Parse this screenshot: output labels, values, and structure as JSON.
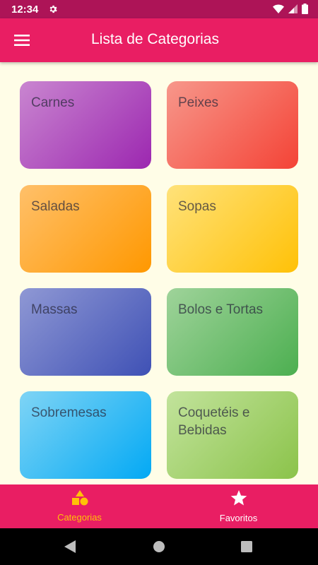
{
  "status": {
    "time": "12:34"
  },
  "app_bar": {
    "title": "Lista de Categorias"
  },
  "categories": [
    {
      "label": "Carnes",
      "color_from": "#c986d0",
      "color_to": "#9c27b0"
    },
    {
      "label": "Peixes",
      "color_from": "#f7978b",
      "color_to": "#f44336"
    },
    {
      "label": "Saladas",
      "color_from": "#ffc06a",
      "color_to": "#ff9800"
    },
    {
      "label": "Sopas",
      "color_from": "#ffe27a",
      "color_to": "#ffc107"
    },
    {
      "label": "Massas",
      "color_from": "#8f98d4",
      "color_to": "#3f51b5"
    },
    {
      "label": "Bolos e Tortas",
      "color_from": "#9fd39a",
      "color_to": "#4caf50"
    },
    {
      "label": "Sobremesas",
      "color_from": "#7fd4f5",
      "color_to": "#03a9f4"
    },
    {
      "label": "Coquetéis e Bebidas",
      "color_from": "#c2e39c",
      "color_to": "#8bc34a"
    }
  ],
  "bottom_nav": {
    "items": [
      {
        "label": "Categorias",
        "icon": "shapes-icon",
        "active": true,
        "color": "#ffc107"
      },
      {
        "label": "Favoritos",
        "icon": "star-icon",
        "active": false,
        "color": "#ffffff"
      }
    ]
  },
  "colors": {
    "status_bar": "#ad1457",
    "app_bar": "#e91e63",
    "background": "#fffde7"
  }
}
